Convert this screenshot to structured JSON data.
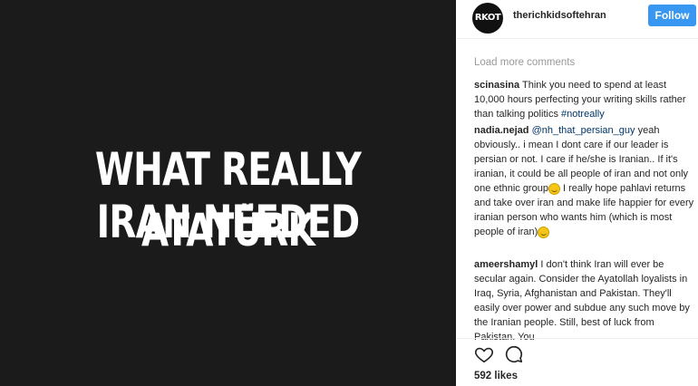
{
  "post": {
    "headline_line1": "WHAT REALLY IRAN NEEDED",
    "headline_line2": "ATATÜRK"
  },
  "header": {
    "avatar_text": "RKOT",
    "username": "therichkidsoftehran",
    "follow_label": "Follow"
  },
  "load_more": "Load more comments",
  "comments": [
    {
      "user": "scinasina",
      "text": "Think you need to spend at least 10,000 hours perfecting your writing skills rather than talking politics",
      "hashtag": "#notreally"
    },
    {
      "user": "nadia.nejad",
      "mention": "@nh_that_persian_guy",
      "text_a": "yeah obviously.. i mean I dont care if our leader is persian or not. I care if he/she is Iranian.. If it's iranian, it could be all people of iran and not only one ethnic group",
      "text_b": "I really hope pahlavi returns and take over iran and make life happier for every iranian person who wants him (which is most people of iran)"
    },
    {
      "user": "ameershamyl",
      "text": "I don't think Iran will ever be secular again. Consider the Ayatollah loyalists in Iraq, Syria, Afghanistan and Pakistan. They'll easily over power and subdue any such move by the Iranian people. Still, best of luck from Pakistan. You"
    }
  ],
  "actions": {
    "like_icon": "heart-icon",
    "comment_icon": "comment-bubble-icon"
  },
  "likes_text": "592 likes",
  "colors": {
    "image_bg": "#1b1b1b",
    "follow_bg": "#3897f0",
    "link": "#003569"
  }
}
